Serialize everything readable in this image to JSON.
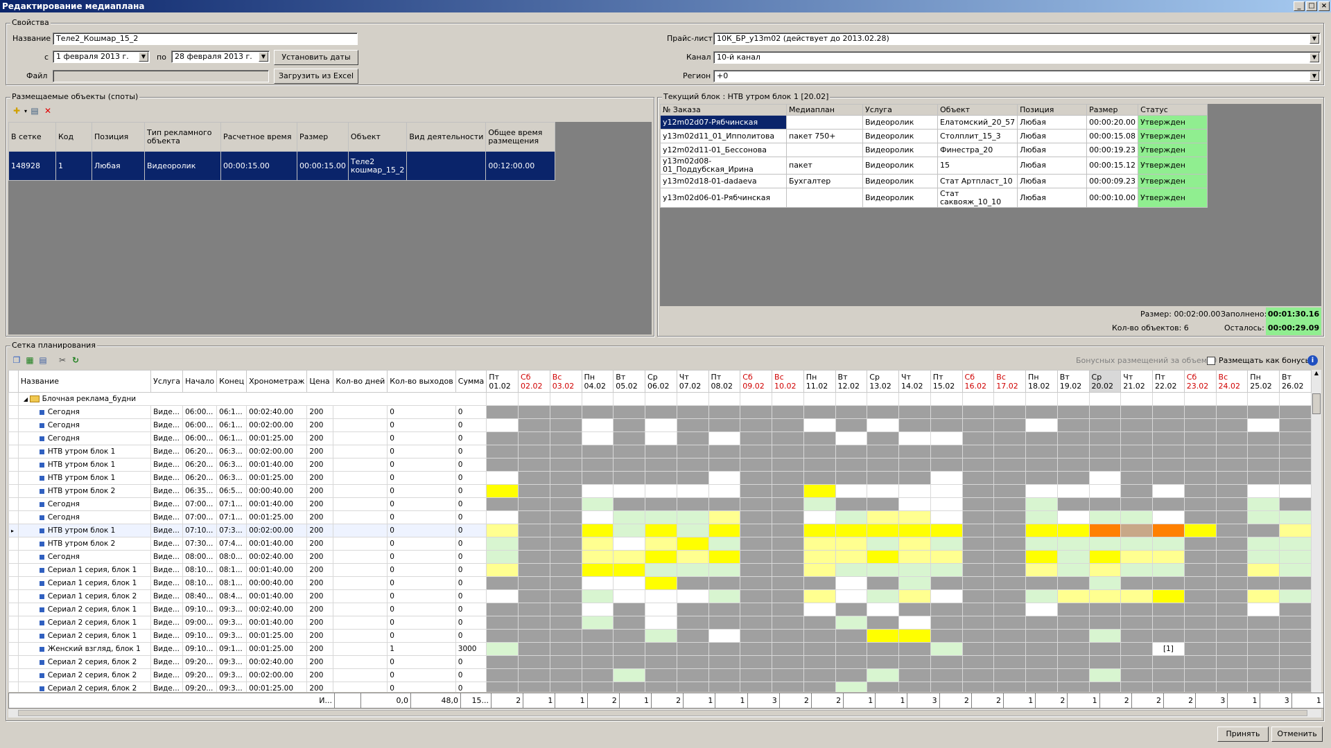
{
  "window": {
    "title": "Редактирование медиаплана"
  },
  "props": {
    "group": "Свойства",
    "name_label": "Название",
    "name": "Теле2_Кошмар_15_2",
    "from_label": "с",
    "date_from": "1  февраля  2013 г.",
    "to_label": "по",
    "date_to": "28  февраля  2013 г.",
    "set_dates": "Установить даты",
    "file_label": "Файл",
    "file": "",
    "load_excel": "Загрузить из Excel",
    "pricelist_label": "Прайс-лист",
    "pricelist": "10К_БР_у13m02 (действует до 2013.02.28)",
    "channel_label": "Канал",
    "channel": "10-й канал",
    "region_label": "Регион",
    "region": "+0"
  },
  "spots": {
    "group": "Размещаемые объекты (споты)",
    "columns": [
      "В сетке",
      "Код",
      "Позиция",
      "Тип рекламного объекта",
      "Расчетное время",
      "Размер",
      "Объект",
      "Вид деятельности",
      "Общее время размещения"
    ],
    "rows": [
      [
        "148928",
        "1",
        "Любая",
        "Видеоролик",
        "00:00:15.00",
        "00:00:15.00",
        "Теле2 кошмар_15_2",
        "",
        "00:12:00.00"
      ]
    ]
  },
  "block": {
    "group": "Текущий блок : НТВ утром блок 1 [20.02]",
    "columns": [
      "№ Заказа",
      "Медиаплан",
      "Услуга",
      "Объект",
      "Позиция",
      "Размер",
      "Статус"
    ],
    "rows": [
      [
        "у12m02d07-Рябчинская",
        "",
        "Видеоролик",
        "Елатомский_20_57",
        "Любая",
        "00:00:20.00",
        "Утвержден"
      ],
      [
        "у13m02d11_01_Ипполитова",
        "пакет 750+",
        "Видеоролик",
        "Столплит_15_3",
        "Любая",
        "00:00:15.08",
        "Утвержден"
      ],
      [
        "у12m02d11-01_Бессонова",
        "",
        "Видеоролик",
        "Финестра_20",
        "Любая",
        "00:00:19.23",
        "Утвержден"
      ],
      [
        "у13m02d08-01_Поддубская_Ирина",
        "пакет",
        "Видеоролик",
        "15",
        "Любая",
        "00:00:15.12",
        "Утвержден"
      ],
      [
        "у13m02d18-01-dadaeva",
        "Бухгалтер",
        "Видеоролик",
        "Стат Артпласт_10",
        "Любая",
        "00:00:09.23",
        "Утвержден"
      ],
      [
        "у13m02d06-01-Рябчинская",
        "",
        "Видеоролик",
        "Стат саквояж_10_10",
        "Любая",
        "00:00:10.00",
        "Утвержден"
      ]
    ],
    "size_label": "Размер: 00:02:00.00",
    "filled_label": "Заполнено:",
    "filled": "00:01:30.16",
    "count_label": "Кол-во объектов: 6",
    "left_label": "Осталось:",
    "left": "00:00:29.09"
  },
  "sched": {
    "group": "Сетка планирования",
    "bonus_label": "Бонусных размещений за объем: 0",
    "bonus_check": "Размещать как бонусы",
    "columns": [
      "Название",
      "Услуга",
      "Начало",
      "Конец",
      "Хронометраж",
      "Цена",
      "Кол-во дней",
      "Кол-во выходов",
      "Сумма"
    ],
    "group_row": "Блочная реклама_будни",
    "days": [
      [
        "Пт",
        "01.02",
        0
      ],
      [
        "Сб",
        "02.02",
        1
      ],
      [
        "Вс",
        "03.02",
        1
      ],
      [
        "Пн",
        "04.02",
        0
      ],
      [
        "Вт",
        "05.02",
        0
      ],
      [
        "Ср",
        "06.02",
        0
      ],
      [
        "Чт",
        "07.02",
        0
      ],
      [
        "Пт",
        "08.02",
        0
      ],
      [
        "Сб",
        "09.02",
        1
      ],
      [
        "Вс",
        "10.02",
        1
      ],
      [
        "Пн",
        "11.02",
        0
      ],
      [
        "Вт",
        "12.02",
        0
      ],
      [
        "Ср",
        "13.02",
        0
      ],
      [
        "Чт",
        "14.02",
        0
      ],
      [
        "Пт",
        "15.02",
        0
      ],
      [
        "Сб",
        "16.02",
        1
      ],
      [
        "Вс",
        "17.02",
        1
      ],
      [
        "Пн",
        "18.02",
        0
      ],
      [
        "Вт",
        "19.02",
        0
      ],
      [
        "Ср",
        "20.02",
        0
      ],
      [
        "Чт",
        "21.02",
        0
      ],
      [
        "Пт",
        "22.02",
        0
      ],
      [
        "Сб",
        "23.02",
        1
      ],
      [
        "Вс",
        "24.02",
        1
      ],
      [
        "Пн",
        "25.02",
        0
      ],
      [
        "Вт",
        "26.02",
        0
      ]
    ],
    "rows": [
      [
        "Сегодня",
        "Виде...",
        "06:00...",
        "06:1...",
        "00:02:40.00",
        "200",
        "",
        "0",
        "0"
      ],
      [
        "Сегодня",
        "Виде...",
        "06:00...",
        "06:1...",
        "00:02:00.00",
        "200",
        "",
        "0",
        "0"
      ],
      [
        "Сегодня",
        "Виде...",
        "06:00...",
        "06:1...",
        "00:01:25.00",
        "200",
        "",
        "0",
        "0"
      ],
      [
        "НТВ утром блок 1",
        "Виде...",
        "06:20...",
        "06:3...",
        "00:02:00.00",
        "200",
        "",
        "0",
        "0"
      ],
      [
        "НТВ утром блок 1",
        "Виде...",
        "06:20...",
        "06:3...",
        "00:01:40.00",
        "200",
        "",
        "0",
        "0"
      ],
      [
        "НТВ утром блок 1",
        "Виде...",
        "06:20...",
        "06:3...",
        "00:01:25.00",
        "200",
        "",
        "0",
        "0"
      ],
      [
        "НТВ утром блок 2",
        "Виде...",
        "06:35...",
        "06:5...",
        "00:00:40.00",
        "200",
        "",
        "0",
        "0"
      ],
      [
        "Сегодня",
        "Виде...",
        "07:00...",
        "07:1...",
        "00:01:40.00",
        "200",
        "",
        "0",
        "0"
      ],
      [
        "Сегодня",
        "Виде...",
        "07:00...",
        "07:1...",
        "00:01:25.00",
        "200",
        "",
        "0",
        "0"
      ],
      [
        "НТВ утром блок 1",
        "Виде...",
        "07:10...",
        "07:3...",
        "00:02:00.00",
        "200",
        "",
        "0",
        "0"
      ],
      [
        "НТВ утром блок 2",
        "Виде...",
        "07:30...",
        "07:4...",
        "00:01:40.00",
        "200",
        "",
        "0",
        "0"
      ],
      [
        "Сегодня",
        "Виде...",
        "08:00...",
        "08:0...",
        "00:02:40.00",
        "200",
        "",
        "0",
        "0"
      ],
      [
        "Сериал 1 серия, блок 1",
        "Виде...",
        "08:10...",
        "08:1...",
        "00:01:40.00",
        "200",
        "",
        "0",
        "0"
      ],
      [
        "Сериал 1 серия, блок 1",
        "Виде...",
        "08:10...",
        "08:1...",
        "00:00:40.00",
        "200",
        "",
        "0",
        "0"
      ],
      [
        "Сериал 1 серия, блок 2",
        "Виде...",
        "08:40...",
        "08:4...",
        "00:01:40.00",
        "200",
        "",
        "0",
        "0"
      ],
      [
        "Сериал 2 серия, блок 1",
        "Виде...",
        "09:10...",
        "09:3...",
        "00:02:40.00",
        "200",
        "",
        "0",
        "0"
      ],
      [
        "Сериал 2 серия, блок 1",
        "Виде...",
        "09:00...",
        "09:3...",
        "00:01:40.00",
        "200",
        "",
        "0",
        "0"
      ],
      [
        "Сериал 2 серия, блок 1",
        "Виде...",
        "09:10...",
        "09:3...",
        "00:01:25.00",
        "200",
        "",
        "0",
        "0"
      ],
      [
        "Женский взгляд, блок 1",
        "Виде...",
        "09:10...",
        "09:1...",
        "00:01:25.00",
        "200",
        "",
        "1",
        "3000"
      ],
      [
        "Сериал 2 серия, блок 2",
        "Виде...",
        "09:20...",
        "09:3...",
        "00:02:40.00",
        "200",
        "",
        "0",
        "0"
      ],
      [
        "Сериал 2 серия, блок 2",
        "Виде...",
        "09:20...",
        "09:3...",
        "00:02:00.00",
        "200",
        "",
        "0",
        "0"
      ],
      [
        "Сериал 2 серия, блок 2",
        "Виде...",
        "09:20...",
        "09:3...",
        "00:01:25.00",
        "200",
        "",
        "0",
        "0"
      ]
    ],
    "cells": [
      "GGGGGGGGGGGGGGGGGGGGGGGGGG",
      "WGGWGWGGGGWGWGGGGWGGGGGGWG",
      "GGGWGWGWGGGWGWWGGGGGGGGGGG",
      "GGGGGGGGGGGGGGGGGGGGGGGGGG",
      "GGGGGGGGGGGGGGGGGGGGGGGGGG",
      "WGGGGGGWGGGGGGWGGGGWGGGGGG",
      "YGGWWWWWGGYWWWWGGWWWGWGGWW",
      "GGGLGGGGGGLGGWWGGLGGGGGGLG",
      "WGGWLLLPGGWLPPWGGLWLLWGGLL",
      "PGGYLYLYGGYYYYYGGYYOSOYGGPY",
      "LGGPWPYLGGPPLPLGGLLLLLGGLL",
      "LGGPPYPYGGPPYPPGGYLYPPGGLL",
      "PGGYYLLLGGPLLLLGGPLPLLGGPL",
      "GGGWWYGGGGGWGLGGGGGLGGGGGG",
      "WGGLWWWLGGPWLPWGGLPPPYGGPL",
      "GGGWGWGGGGWGWGGGGWGGGGGGWG",
      "GGGLGWGGGGGLGWGGGGGGGGGGGG",
      "GGGGGLGWGGGGYYGGGGGLGGGGGG",
      "LGGGGGGGGGGGGGLGGGGGGWGGGG",
      "GGGGGGGGGGGGGGGGGGGGGGGGGG",
      "GGGGLGGGGGGGLGGGGGGLGGGGGG",
      "GGGGGGGGGGGLGGGGGGGGGGGGGG"
    ],
    "cell_text": {
      "18-21": "[1]"
    },
    "footer": {
      "label": "И...",
      "days": "0,0",
      "outs": "48,0",
      "sum": "15...",
      "day_totals": [
        "2",
        "1",
        "1",
        "2",
        "1",
        "2",
        "1",
        "1",
        "3",
        "2",
        "2",
        "1",
        "1",
        "3",
        "2",
        "2",
        "1",
        "2",
        "1",
        "2",
        "2",
        "2",
        "3",
        "1",
        "3",
        "1"
      ]
    }
  },
  "colors": {
    "G": "#a0a0a0",
    "W": "#ffffff",
    "Y": "#ffff00",
    "P": "#ffff90",
    "L": "#d8f5d0",
    "O": "#ff8000",
    "S": "#c8a888"
  },
  "buttons": {
    "ok": "Принять",
    "cancel": "Отменить"
  }
}
